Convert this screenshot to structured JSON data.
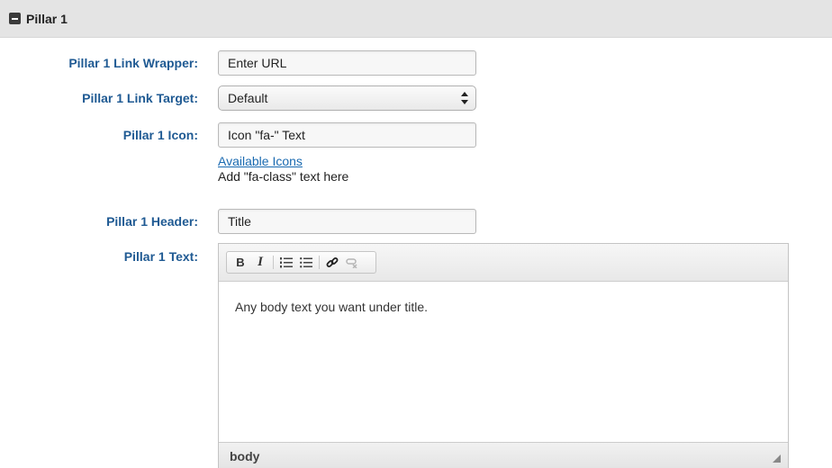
{
  "section": {
    "title": "Pillar 1",
    "collapse_icon": "minus-square-icon"
  },
  "fields": {
    "link_wrapper": {
      "label": "Pillar 1 Link Wrapper:",
      "value": "Enter URL"
    },
    "link_target": {
      "label": "Pillar 1 Link Target:",
      "selected": "Default"
    },
    "icon": {
      "label": "Pillar 1 Icon:",
      "value": "Icon \"fa-\" Text",
      "help_link": "Available Icons",
      "help_text": "Add \"fa-class\" text here"
    },
    "header": {
      "label": "Pillar 1 Header:",
      "value": "Title"
    },
    "text": {
      "label": "Pillar 1 Text:",
      "toolbar": {
        "bold": "B",
        "italic": "I",
        "icons": [
          "bold-icon",
          "italic-icon",
          "numbered-list-icon",
          "bulleted-list-icon",
          "link-icon",
          "unlink-icon"
        ]
      },
      "content": "Any body text you want under title.",
      "status_path": "body"
    }
  },
  "colors": {
    "label": "#1f5a93",
    "link": "#1a6ab1",
    "header_bg": "#e4e4e4"
  }
}
